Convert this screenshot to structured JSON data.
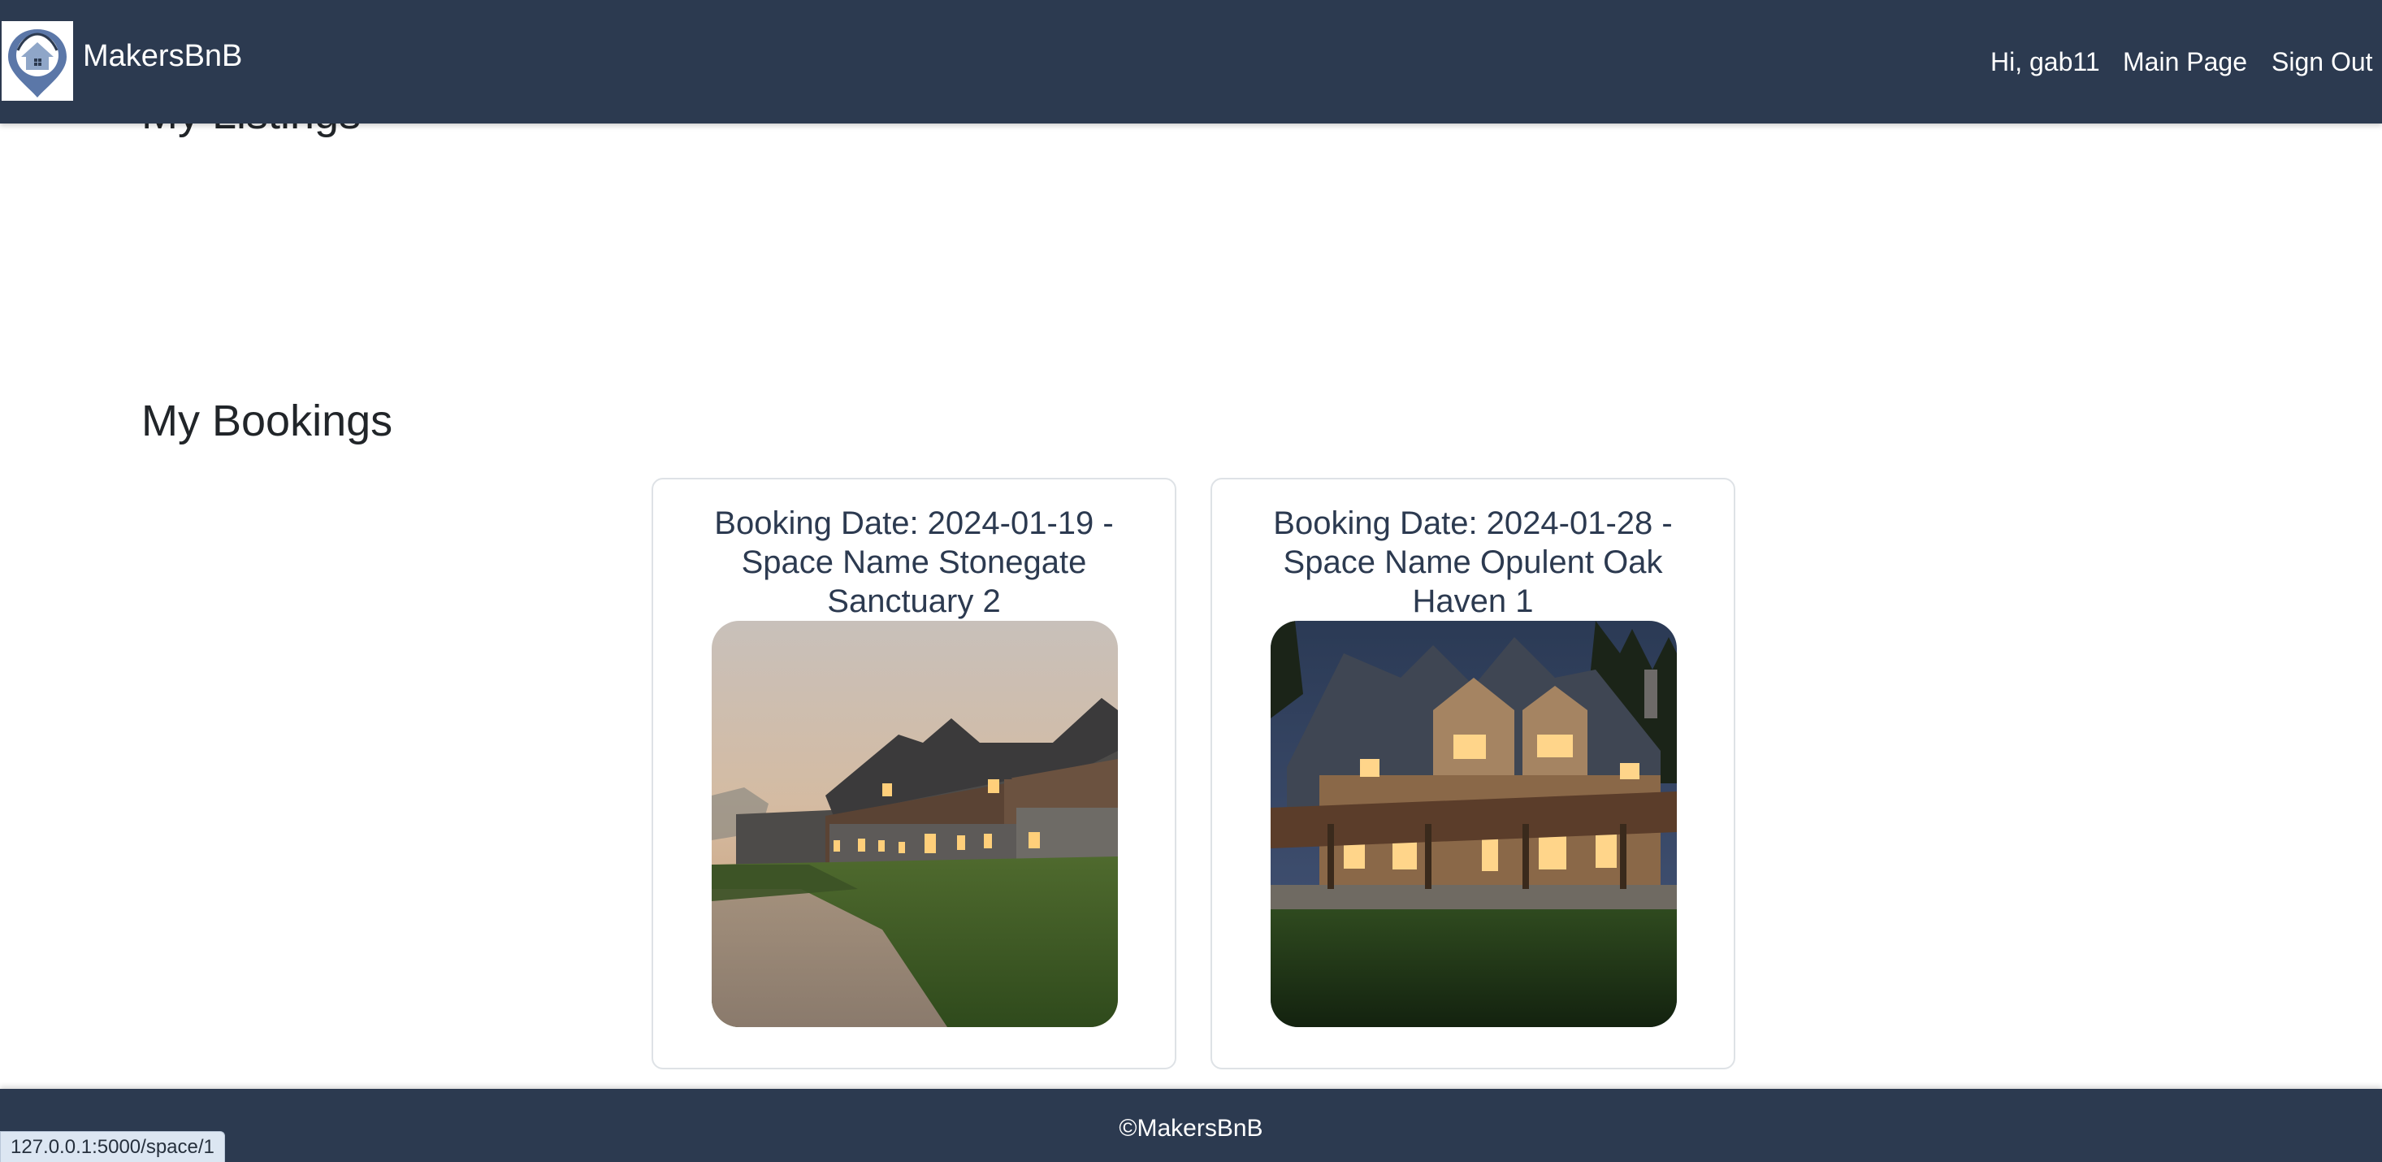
{
  "navbar": {
    "brand": "MakersBnB",
    "greeting": "Hi, gab11",
    "main_page": "Main Page",
    "sign_out": "Sign Out",
    "logo_icon": "location-pin-house-logo-icon"
  },
  "main": {
    "listings_heading": "My Listings",
    "bookings_heading": "My Bookings",
    "bookings": [
      {
        "title": "Booking Date: 2024-01-19 - Space Name Stonegate Sanctuary 2",
        "image": "stone-farmhouse-dusk-image"
      },
      {
        "title": "Booking Date: 2024-01-28 - Space Name Opulent Oak Haven 1",
        "image": "timber-manor-night-image"
      }
    ]
  },
  "footer": {
    "text": "©MakersBnB"
  },
  "status_bar": {
    "url": "127.0.0.1:5000/space/1"
  },
  "colors": {
    "navbar": "#2c3a50",
    "text": "#212529",
    "card_border": "#dee2e6"
  }
}
